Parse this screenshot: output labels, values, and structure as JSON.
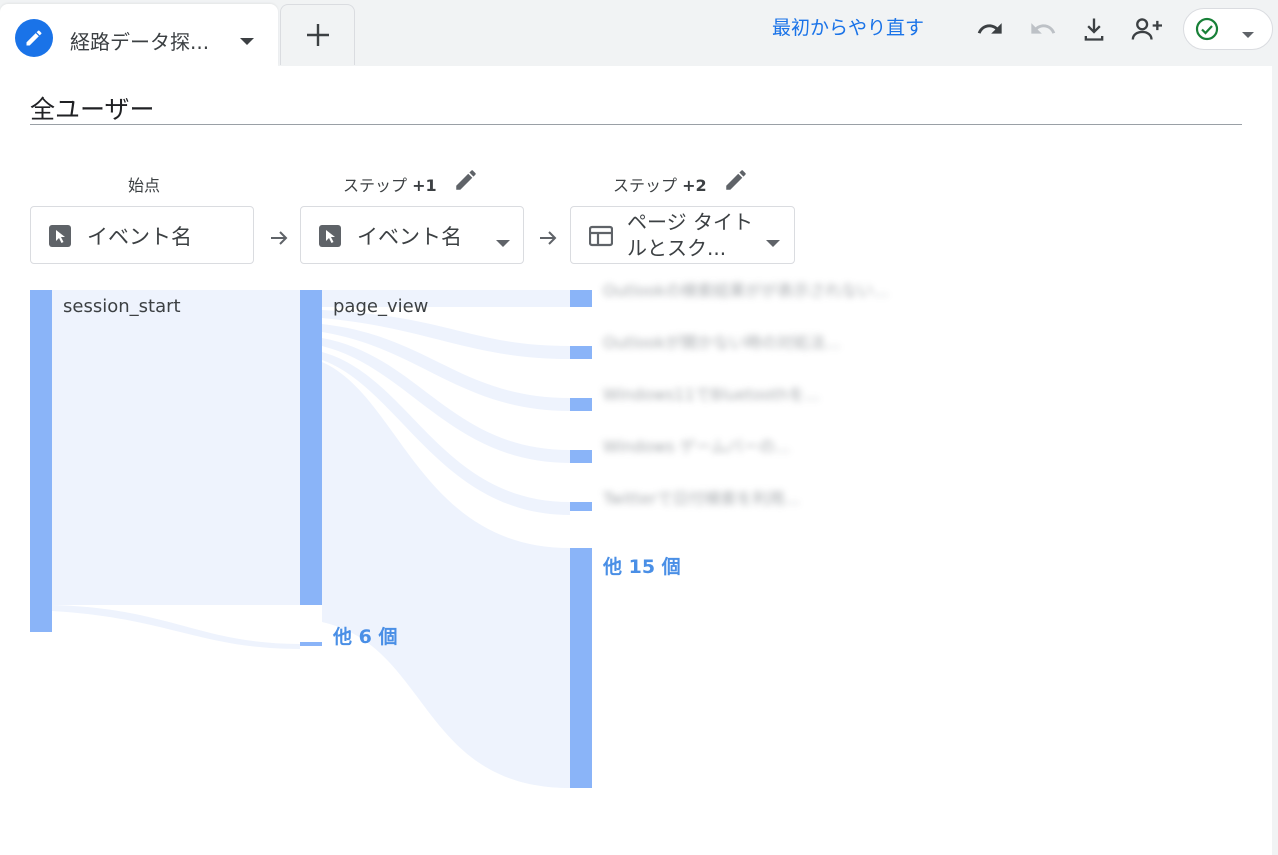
{
  "tab": {
    "title": "経路データ探..."
  },
  "toolbar": {
    "restart_label": "最初からやり直す",
    "icons": [
      "undo-icon",
      "redo-icon",
      "download-icon",
      "share-user-icon",
      "check-circle-icon"
    ]
  },
  "segment": {
    "title": "全ユーザー"
  },
  "steps": [
    {
      "label": "始点",
      "dimension": "イベント名"
    },
    {
      "label": "ステップ",
      "increment": "+1",
      "dimension": "イベント名"
    },
    {
      "label": "ステップ",
      "increment": "+2",
      "dimension": "ページ タイトルとスク..."
    }
  ],
  "nodes": {
    "start": "session_start",
    "step1": "page_view",
    "step1_more": "他 6 個",
    "step2_more": "他 15 個"
  },
  "step2_items": [
    "Outlookの検索結果がが表示されない...",
    "Outlookが開かない時の対処法...",
    "Windows11でBluetoothを...",
    "Windows ゲームバーの...",
    "Twitterで日付検索を利用..."
  ],
  "colors": {
    "node": "#8ab4f8",
    "flow": "#e8effb",
    "accent": "#1a73e8"
  }
}
